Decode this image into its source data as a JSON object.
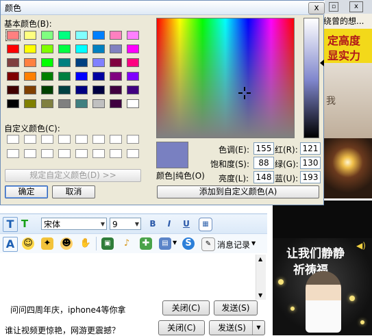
{
  "dialog": {
    "title": "颜色",
    "close_label": "x",
    "basic_colors_label": "基本颜色(B):",
    "custom_colors_label": "自定义颜色(C):",
    "define_custom_label": "规定自定义颜色(D) >>",
    "ok_label": "确定",
    "cancel_label": "取消",
    "color_solid_label": "颜色|纯色(O)",
    "add_custom_label": "添加到自定义颜色(A)",
    "fields": {
      "hue_label": "色调(E):",
      "hue": "155",
      "sat_label": "饱和度(S):",
      "sat": "88",
      "lum_label": "亮度(L):",
      "lum": "148",
      "red_label": "红(R):",
      "red": "121",
      "green_label": "绿(G):",
      "green": "130",
      "blue_label": "蓝(U):",
      "blue": "193"
    },
    "basic_colors": [
      "#ff8080",
      "#ffff80",
      "#80ff80",
      "#00ff80",
      "#80ffff",
      "#0080ff",
      "#ff80c0",
      "#ff80ff",
      "#ff0000",
      "#ffff00",
      "#80ff00",
      "#00ff40",
      "#00ffff",
      "#0080c0",
      "#8080c0",
      "#ff00ff",
      "#804040",
      "#ff8040",
      "#00ff00",
      "#008080",
      "#004080",
      "#8080ff",
      "#800040",
      "#ff0080",
      "#800000",
      "#ff8000",
      "#008000",
      "#008040",
      "#0000ff",
      "#0000a0",
      "#800080",
      "#8000ff",
      "#400000",
      "#804000",
      "#004000",
      "#004040",
      "#000080",
      "#000040",
      "#400040",
      "#400080",
      "#000000",
      "#808000",
      "#808040",
      "#808080",
      "#408080",
      "#c0c0c0",
      "#400040",
      "#ffffff"
    ],
    "preview_color": "#7980c1"
  },
  "chat": {
    "font_name": "宋体",
    "font_size": "9",
    "bold": "B",
    "italic": "I",
    "underline": "U",
    "history_label": "消息记录",
    "message_text": "问问四周年庆，iphone4等你拿",
    "close_label_1": "关闭(C)",
    "send_label_1": "发送(S)",
    "ad_text": "谁让视频更惊艳，网游更震撼？",
    "close_label_2": "关闭(C)",
    "send_label_2": "发送(S)"
  },
  "ads": {
    "top_line_1": "绕曾的想...",
    "top_line_2": "定高度",
    "top_line_3": "显实力",
    "top_line_4": "我",
    "right_line_1": "让我们静静",
    "right_line_2": "祈祷福"
  }
}
